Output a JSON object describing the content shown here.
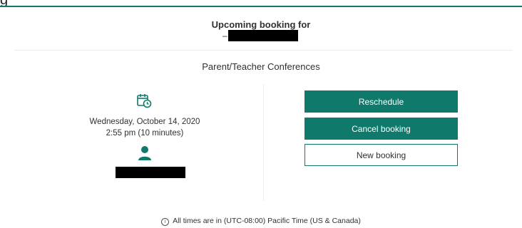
{
  "page_fragment": "g",
  "header": {
    "title": "Upcoming booking for",
    "customer_prefix": "–"
  },
  "service": {
    "name": "Parent/Teacher Conferences"
  },
  "booking": {
    "date": "Wednesday, October 14, 2020",
    "time": "2:55 pm (10 minutes)"
  },
  "actions": {
    "reschedule": "Reschedule",
    "cancel": "Cancel booking",
    "new_booking": "New booking"
  },
  "footer": {
    "timezone_note": "All times are in (UTC-08:00) Pacific Time (US & Canada)"
  },
  "icons": {
    "calendar": "calendar-clock-icon",
    "person": "person-icon",
    "info": "info-icon"
  },
  "colors": {
    "accent": "#0f7a6c",
    "divider": "#edebe9",
    "text": "#323130"
  }
}
